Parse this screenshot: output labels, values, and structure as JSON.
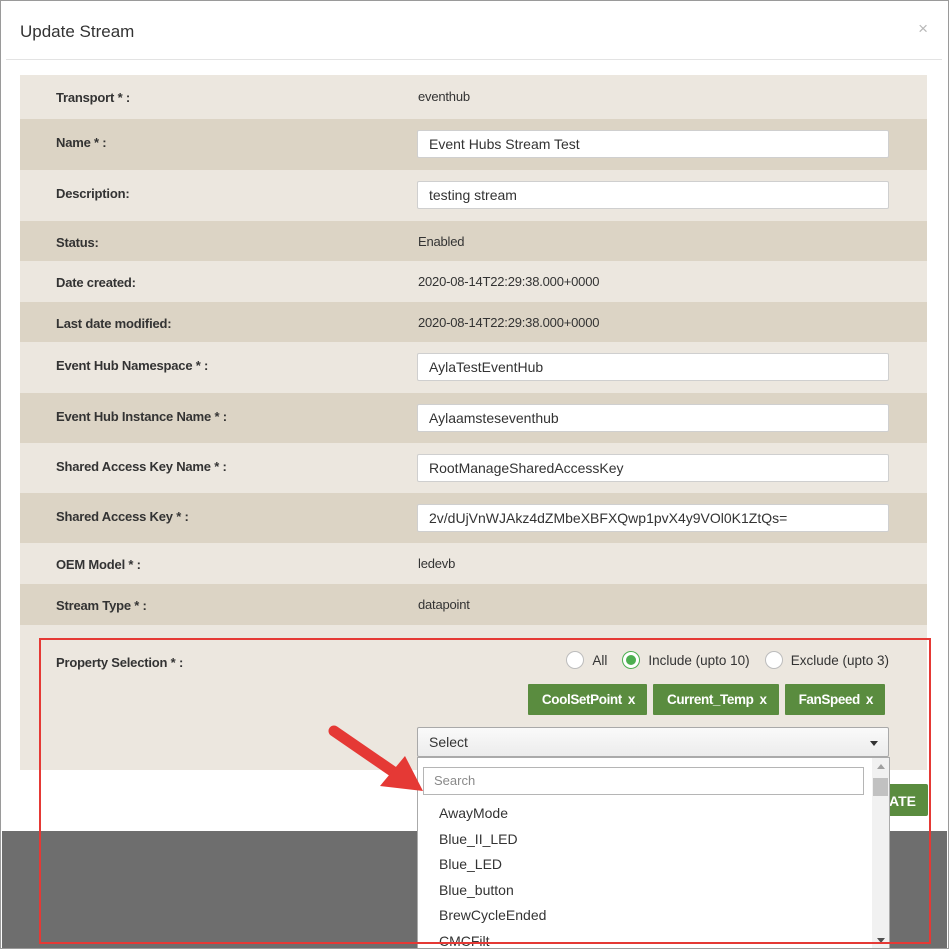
{
  "modal": {
    "title": "Update Stream",
    "close_glyph": "×"
  },
  "fields": {
    "transport": {
      "label": "Transport * :",
      "value": "eventhub"
    },
    "name": {
      "label": "Name * :",
      "value": "Event Hubs Stream Test"
    },
    "description": {
      "label": "Description:",
      "value": "testing stream"
    },
    "status": {
      "label": "Status:",
      "value": "Enabled"
    },
    "date_created": {
      "label": "Date created:",
      "value": "2020-08-14T22:29:38.000+0000"
    },
    "last_modified": {
      "label": "Last date modified:",
      "value": "2020-08-14T22:29:38.000+0000"
    },
    "namespace": {
      "label": "Event Hub Namespace * :",
      "value": "AylaTestEventHub"
    },
    "instance_name": {
      "label": "Event Hub Instance Name * :",
      "value": "Aylaamsteseventhub"
    },
    "key_name": {
      "label": "Shared Access Key Name * :",
      "value": "RootManageSharedAccessKey"
    },
    "access_key": {
      "label": "Shared Access Key * :",
      "value": "2v/dUjVnWJAkz4dZMbeXBFXQwp1pvX4y9VOl0K1ZtQs="
    },
    "oem_model": {
      "label": "OEM Model * :",
      "value": "ledevb"
    },
    "stream_type": {
      "label": "Stream Type * :",
      "value": "datapoint"
    }
  },
  "property_selection": {
    "label": "Property Selection * :",
    "radios": {
      "all": "All",
      "include": "Include (upto 10)",
      "exclude": "Exclude (upto 3)",
      "selected": "include"
    },
    "chips": [
      "CoolSetPoint",
      "Current_Temp",
      "FanSpeed"
    ],
    "chip_remove": "x",
    "select_value": "Select",
    "search_placeholder": "Search",
    "options": [
      "AwayMode",
      "Blue_II_LED",
      "Blue_LED",
      "Blue_button",
      "BrewCycleEnded",
      "CMCFilt"
    ]
  },
  "submit_button": {
    "visible_text": "ATE"
  },
  "colors": {
    "chip": "#5a8c3f",
    "radio_on": "#4caf50",
    "highlight": "#e53935",
    "row_dark": "#dcd4c5",
    "row_light": "#ece7df"
  }
}
